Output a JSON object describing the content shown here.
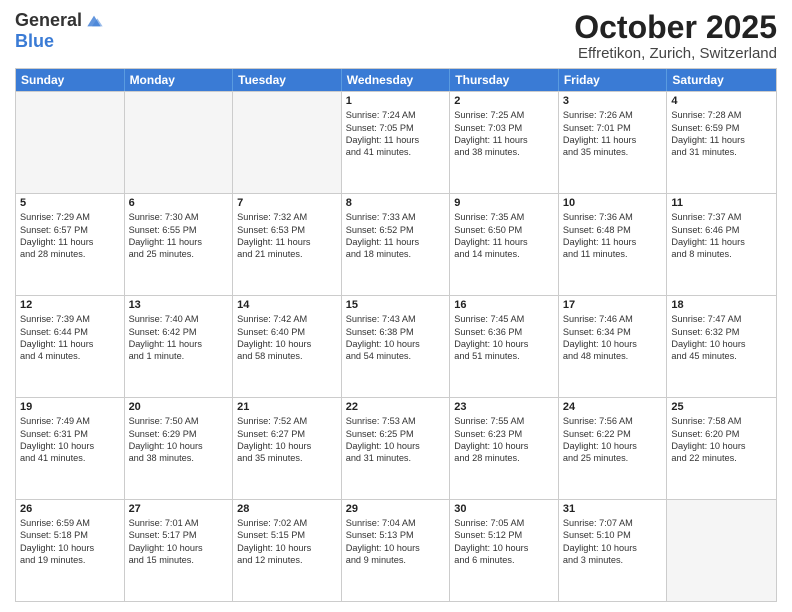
{
  "header": {
    "logo_general": "General",
    "logo_blue": "Blue",
    "month": "October 2025",
    "location": "Effretikon, Zurich, Switzerland"
  },
  "weekdays": [
    "Sunday",
    "Monday",
    "Tuesday",
    "Wednesday",
    "Thursday",
    "Friday",
    "Saturday"
  ],
  "rows": [
    [
      {
        "day": "",
        "empty": true
      },
      {
        "day": "",
        "empty": true
      },
      {
        "day": "",
        "empty": true
      },
      {
        "day": "1",
        "lines": [
          "Sunrise: 7:24 AM",
          "Sunset: 7:05 PM",
          "Daylight: 11 hours",
          "and 41 minutes."
        ]
      },
      {
        "day": "2",
        "lines": [
          "Sunrise: 7:25 AM",
          "Sunset: 7:03 PM",
          "Daylight: 11 hours",
          "and 38 minutes."
        ]
      },
      {
        "day": "3",
        "lines": [
          "Sunrise: 7:26 AM",
          "Sunset: 7:01 PM",
          "Daylight: 11 hours",
          "and 35 minutes."
        ]
      },
      {
        "day": "4",
        "lines": [
          "Sunrise: 7:28 AM",
          "Sunset: 6:59 PM",
          "Daylight: 11 hours",
          "and 31 minutes."
        ]
      }
    ],
    [
      {
        "day": "5",
        "lines": [
          "Sunrise: 7:29 AM",
          "Sunset: 6:57 PM",
          "Daylight: 11 hours",
          "and 28 minutes."
        ]
      },
      {
        "day": "6",
        "lines": [
          "Sunrise: 7:30 AM",
          "Sunset: 6:55 PM",
          "Daylight: 11 hours",
          "and 25 minutes."
        ]
      },
      {
        "day": "7",
        "lines": [
          "Sunrise: 7:32 AM",
          "Sunset: 6:53 PM",
          "Daylight: 11 hours",
          "and 21 minutes."
        ]
      },
      {
        "day": "8",
        "lines": [
          "Sunrise: 7:33 AM",
          "Sunset: 6:52 PM",
          "Daylight: 11 hours",
          "and 18 minutes."
        ]
      },
      {
        "day": "9",
        "lines": [
          "Sunrise: 7:35 AM",
          "Sunset: 6:50 PM",
          "Daylight: 11 hours",
          "and 14 minutes."
        ]
      },
      {
        "day": "10",
        "lines": [
          "Sunrise: 7:36 AM",
          "Sunset: 6:48 PM",
          "Daylight: 11 hours",
          "and 11 minutes."
        ]
      },
      {
        "day": "11",
        "lines": [
          "Sunrise: 7:37 AM",
          "Sunset: 6:46 PM",
          "Daylight: 11 hours",
          "and 8 minutes."
        ]
      }
    ],
    [
      {
        "day": "12",
        "lines": [
          "Sunrise: 7:39 AM",
          "Sunset: 6:44 PM",
          "Daylight: 11 hours",
          "and 4 minutes."
        ]
      },
      {
        "day": "13",
        "lines": [
          "Sunrise: 7:40 AM",
          "Sunset: 6:42 PM",
          "Daylight: 11 hours",
          "and 1 minute."
        ]
      },
      {
        "day": "14",
        "lines": [
          "Sunrise: 7:42 AM",
          "Sunset: 6:40 PM",
          "Daylight: 10 hours",
          "and 58 minutes."
        ]
      },
      {
        "day": "15",
        "lines": [
          "Sunrise: 7:43 AM",
          "Sunset: 6:38 PM",
          "Daylight: 10 hours",
          "and 54 minutes."
        ]
      },
      {
        "day": "16",
        "lines": [
          "Sunrise: 7:45 AM",
          "Sunset: 6:36 PM",
          "Daylight: 10 hours",
          "and 51 minutes."
        ]
      },
      {
        "day": "17",
        "lines": [
          "Sunrise: 7:46 AM",
          "Sunset: 6:34 PM",
          "Daylight: 10 hours",
          "and 48 minutes."
        ]
      },
      {
        "day": "18",
        "lines": [
          "Sunrise: 7:47 AM",
          "Sunset: 6:32 PM",
          "Daylight: 10 hours",
          "and 45 minutes."
        ]
      }
    ],
    [
      {
        "day": "19",
        "lines": [
          "Sunrise: 7:49 AM",
          "Sunset: 6:31 PM",
          "Daylight: 10 hours",
          "and 41 minutes."
        ]
      },
      {
        "day": "20",
        "lines": [
          "Sunrise: 7:50 AM",
          "Sunset: 6:29 PM",
          "Daylight: 10 hours",
          "and 38 minutes."
        ]
      },
      {
        "day": "21",
        "lines": [
          "Sunrise: 7:52 AM",
          "Sunset: 6:27 PM",
          "Daylight: 10 hours",
          "and 35 minutes."
        ]
      },
      {
        "day": "22",
        "lines": [
          "Sunrise: 7:53 AM",
          "Sunset: 6:25 PM",
          "Daylight: 10 hours",
          "and 31 minutes."
        ]
      },
      {
        "day": "23",
        "lines": [
          "Sunrise: 7:55 AM",
          "Sunset: 6:23 PM",
          "Daylight: 10 hours",
          "and 28 minutes."
        ]
      },
      {
        "day": "24",
        "lines": [
          "Sunrise: 7:56 AM",
          "Sunset: 6:22 PM",
          "Daylight: 10 hours",
          "and 25 minutes."
        ]
      },
      {
        "day": "25",
        "lines": [
          "Sunrise: 7:58 AM",
          "Sunset: 6:20 PM",
          "Daylight: 10 hours",
          "and 22 minutes."
        ]
      }
    ],
    [
      {
        "day": "26",
        "lines": [
          "Sunrise: 6:59 AM",
          "Sunset: 5:18 PM",
          "Daylight: 10 hours",
          "and 19 minutes."
        ]
      },
      {
        "day": "27",
        "lines": [
          "Sunrise: 7:01 AM",
          "Sunset: 5:17 PM",
          "Daylight: 10 hours",
          "and 15 minutes."
        ]
      },
      {
        "day": "28",
        "lines": [
          "Sunrise: 7:02 AM",
          "Sunset: 5:15 PM",
          "Daylight: 10 hours",
          "and 12 minutes."
        ]
      },
      {
        "day": "29",
        "lines": [
          "Sunrise: 7:04 AM",
          "Sunset: 5:13 PM",
          "Daylight: 10 hours",
          "and 9 minutes."
        ]
      },
      {
        "day": "30",
        "lines": [
          "Sunrise: 7:05 AM",
          "Sunset: 5:12 PM",
          "Daylight: 10 hours",
          "and 6 minutes."
        ]
      },
      {
        "day": "31",
        "lines": [
          "Sunrise: 7:07 AM",
          "Sunset: 5:10 PM",
          "Daylight: 10 hours",
          "and 3 minutes."
        ]
      },
      {
        "day": "",
        "empty": true
      }
    ]
  ]
}
